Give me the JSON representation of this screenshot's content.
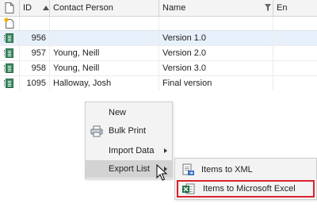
{
  "grid": {
    "columns": {
      "id": "ID",
      "contact": "Contact Person",
      "name": "Name",
      "extra": "En"
    },
    "rows": [
      {
        "id": "956",
        "contact": "",
        "name": "Version 1.0",
        "selected": true
      },
      {
        "id": "957",
        "contact": "Young, Neill",
        "name": "Version 2.0",
        "selected": false
      },
      {
        "id": "958",
        "contact": "Young, Neill",
        "name": "Version 3.0",
        "selected": false
      },
      {
        "id": "1095",
        "contact": "Halloway, Josh",
        "name": "Final version",
        "selected": false
      }
    ]
  },
  "context_menu": {
    "items": [
      {
        "label": "New",
        "icon": "none",
        "submenu": false
      },
      {
        "label": "Bulk Print",
        "icon": "print-icon",
        "submenu": false
      },
      {
        "label": "Import Data",
        "icon": "none",
        "submenu": true
      },
      {
        "label": "Export List",
        "icon": "none",
        "submenu": true,
        "hovered": true
      }
    ]
  },
  "export_submenu": {
    "items": [
      {
        "label": "Items to XML",
        "icon": "xml-export-icon"
      },
      {
        "label": "Items to Microsoft Excel",
        "icon": "excel-export-icon",
        "highlighted": true
      }
    ]
  },
  "colors": {
    "selected_row": "#e8f1fb",
    "menu_bg": "#f3f3f3",
    "menu_hover": "#d3d3d3",
    "highlight_border": "#d9232d",
    "doc_icon": "#3f8a63"
  }
}
